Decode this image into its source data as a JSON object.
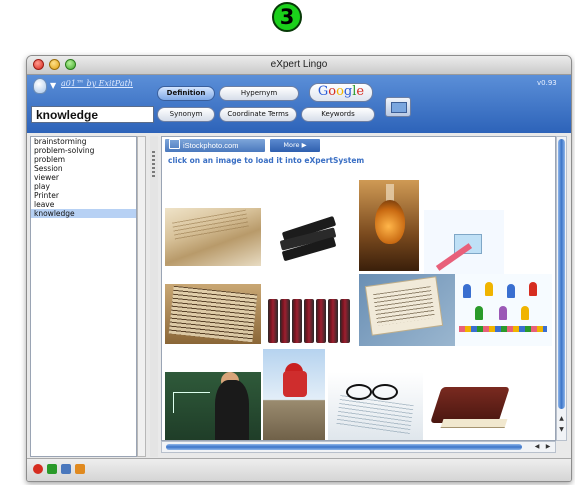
{
  "step_badge": "3",
  "window": {
    "title": "eXpert Lingo"
  },
  "toolbar": {
    "logo_text": "a01™ by ExitPath",
    "search_value": "knowledge",
    "version": "v0.93",
    "buttons": {
      "definition": "Definition",
      "hypernym": "Hypernym",
      "synonym": "Synonym",
      "coordinate_terms": "Coordinate Terms",
      "keywords": "Keywords",
      "google": "Google"
    }
  },
  "sidebar": {
    "words": [
      "brainstorming",
      "problem-solving",
      "problem",
      "Session",
      "viewer",
      "play",
      "Printer",
      "leave",
      "knowledge"
    ],
    "selected_index": 8
  },
  "main": {
    "istock_label": "iStockphoto.com",
    "more_label": "More ▶",
    "hint": "click on an image to load it into eXpertSystem",
    "images": [
      "old-paper-icon",
      "stacked-books-icon",
      "flask-icon",
      "diagram-icon",
      "open-book-icon",
      "book-spines-icon",
      "journal-icon",
      "pegs-icon",
      "teacher-icon",
      "boy-reading-icon",
      "glasses-icon",
      "closed-book-icon"
    ]
  },
  "scroll": {
    "up": "▲",
    "down": "▼",
    "left": "◀",
    "right": "▶"
  },
  "colors": {
    "toolbar": "#2d63b9",
    "selection": "#b7d1f4",
    "hint": "#3a6fc4",
    "badge": "#1bd11b"
  }
}
